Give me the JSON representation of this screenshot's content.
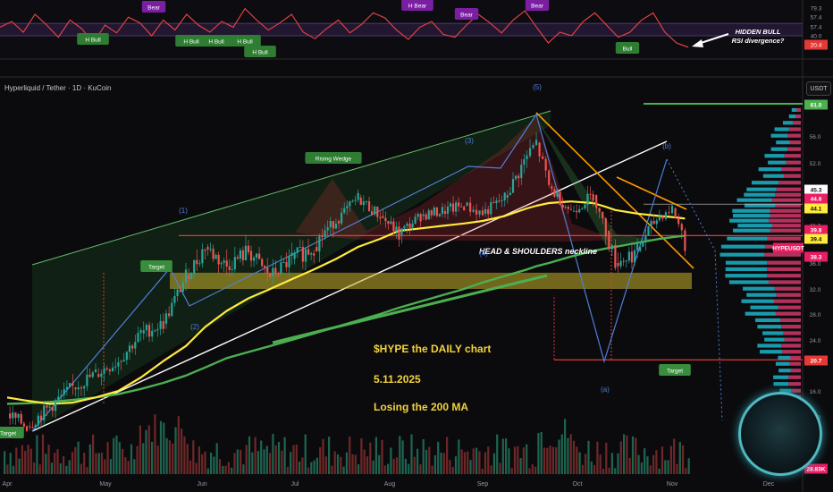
{
  "header": {
    "pair_title": "Hyperliquid / Tether · 1D · KuCoin",
    "currency": "USDT"
  },
  "chart_data": {
    "type": "line",
    "title": "$HYPE   the DAILY chart",
    "date_text": "5.11.2025",
    "subtitle": "Losing the 200 MA",
    "x_tick_labels": [
      "Apr",
      "May",
      "Jun",
      "Jul",
      "Aug",
      "Sep",
      "Oct",
      "Nov",
      "Dec"
    ],
    "price_axis_ticks": [
      61.0,
      56.0,
      52.0,
      48.0,
      44.1,
      41.2,
      39.8,
      36.0,
      32.0,
      28.0,
      24.0,
      20.7,
      16.0,
      12.0,
      8.0
    ],
    "price_tags": [
      {
        "label": "61.0",
        "color": "#4caf50"
      },
      {
        "label": "45.3",
        "color": "#ffffff"
      },
      {
        "label": "44.8",
        "color": "#e91e63"
      },
      {
        "label": "44.1",
        "color": "#ffeb3b"
      },
      {
        "label": "39.8",
        "color": "#e91e63"
      },
      {
        "label": "39.4",
        "color": "#ffeb3b"
      },
      {
        "label": "HYPEUSDT",
        "color": "#e91e63"
      },
      {
        "label": "38.3",
        "color": "#e91e63"
      },
      {
        "label": "20.7",
        "color": "#e53935"
      },
      {
        "label": "28.83K",
        "color": "#e91e63"
      }
    ],
    "price_series": {
      "name": "HYPEUSDT",
      "x": [
        "Apr 1",
        "Apr 7",
        "Apr 14",
        "Apr 21",
        "Apr 28",
        "May 5",
        "May 12",
        "May 19",
        "May 26",
        "Jun 2",
        "Jun 9",
        "Jun 16",
        "Jun 23",
        "Jun 30",
        "Jul 7",
        "Jul 14",
        "Jul 21",
        "Jul 28",
        "Aug 4",
        "Aug 11",
        "Aug 18",
        "Aug 25",
        "Sep 1",
        "Sep 8",
        "Sep 15",
        "Sep 18",
        "Sep 22",
        "Sep 29",
        "Oct 6",
        "Oct 10",
        "Oct 13",
        "Oct 20",
        "Oct 27",
        "Nov 1",
        "Nov 5"
      ],
      "values": [
        12.5,
        10.5,
        13.5,
        16.5,
        18.5,
        20.5,
        25.0,
        26.5,
        34.0,
        38.0,
        35.5,
        37.5,
        34.0,
        36.5,
        38.0,
        42.0,
        46.5,
        43.0,
        39.5,
        43.0,
        44.0,
        45.0,
        43.5,
        46.5,
        53.0,
        55.0,
        48.5,
        44.0,
        47.0,
        40.0,
        36.0,
        37.5,
        43.0,
        44.5,
        38.3
      ]
    },
    "ma50": {
      "name": "50 MA",
      "color": "#ffeb3b",
      "values": [
        15.0,
        14.5,
        14.0,
        14.2,
        15.0,
        16.0,
        18.0,
        20.5,
        23.0,
        26.0,
        28.5,
        30.5,
        32.0,
        33.5,
        35.0,
        36.5,
        38.0,
        39.0,
        40.0,
        40.5,
        41.0,
        41.5,
        42.0,
        43.0,
        44.5,
        45.0,
        45.5,
        45.8,
        45.5,
        44.8,
        44.2,
        43.5,
        43.0,
        42.8,
        42.5
      ]
    },
    "ma200": {
      "name": "200 MA",
      "color": "#4caf50",
      "values": [
        14.0,
        14.1,
        14.3,
        14.6,
        15.0,
        15.5,
        16.3,
        17.2,
        18.3,
        19.5,
        21.0,
        22.0,
        23.0,
        24.0,
        25.0,
        26.0,
        27.0,
        28.0,
        29.0,
        30.0,
        31.0,
        32.0,
        33.0,
        34.0,
        35.0,
        35.5,
        36.0,
        36.8,
        37.5,
        37.8,
        38.0,
        38.5,
        39.0,
        39.2,
        39.4
      ]
    },
    "annotations": {
      "rising_wedge": "Rising Wedge",
      "neckline": "HEAD & SHOULDERS neckline",
      "target_left": "Target",
      "target_right": "Target",
      "target_bottom_left": "Target",
      "wave_1": "(1)",
      "wave_2": "(2)",
      "wave_3": "(3)",
      "wave_4": "(4)",
      "wave_5": "(5)",
      "wave_a": "(a)",
      "wave_b": "(b)",
      "rsi_note_1": "HIDDEN BULL",
      "rsi_note_2": "RSI divergence?"
    },
    "levels": {
      "top_target": 61.0,
      "neckline": 39.4,
      "support_zone": [
        32.0,
        34.5
      ],
      "lower_target": 20.7
    },
    "rsi_panel": {
      "tick_labels": [
        "79.3",
        "57.4",
        "57.4",
        "40.0",
        "20.4"
      ],
      "signals": [
        {
          "label": "Bear",
          "kind": "bear"
        },
        {
          "label": "H Bull",
          "kind": "bull"
        },
        {
          "label": "H Bull",
          "kind": "bull"
        },
        {
          "label": "H Bull",
          "kind": "bull"
        },
        {
          "label": "H Bull",
          "kind": "bull"
        },
        {
          "label": "H Bull",
          "kind": "bull"
        },
        {
          "label": "H Bear",
          "kind": "bear"
        },
        {
          "label": "Bear",
          "kind": "bear"
        },
        {
          "label": "Bear",
          "kind": "bear"
        },
        {
          "label": "Bull",
          "kind": "bull"
        }
      ],
      "rsi_values": [
        52,
        60,
        45,
        70,
        55,
        38,
        62,
        50,
        30,
        55,
        44,
        66,
        58,
        40,
        62,
        48,
        70,
        55,
        45,
        60,
        52,
        78,
        62,
        48,
        58,
        70,
        45,
        36,
        50,
        62,
        44,
        56,
        72,
        65,
        48,
        35,
        52,
        60,
        42,
        38,
        55,
        70,
        58,
        44,
        62,
        75,
        52,
        30,
        45,
        40,
        60,
        72,
        55,
        38,
        45,
        62,
        72,
        45,
        30,
        24
      ]
    }
  }
}
